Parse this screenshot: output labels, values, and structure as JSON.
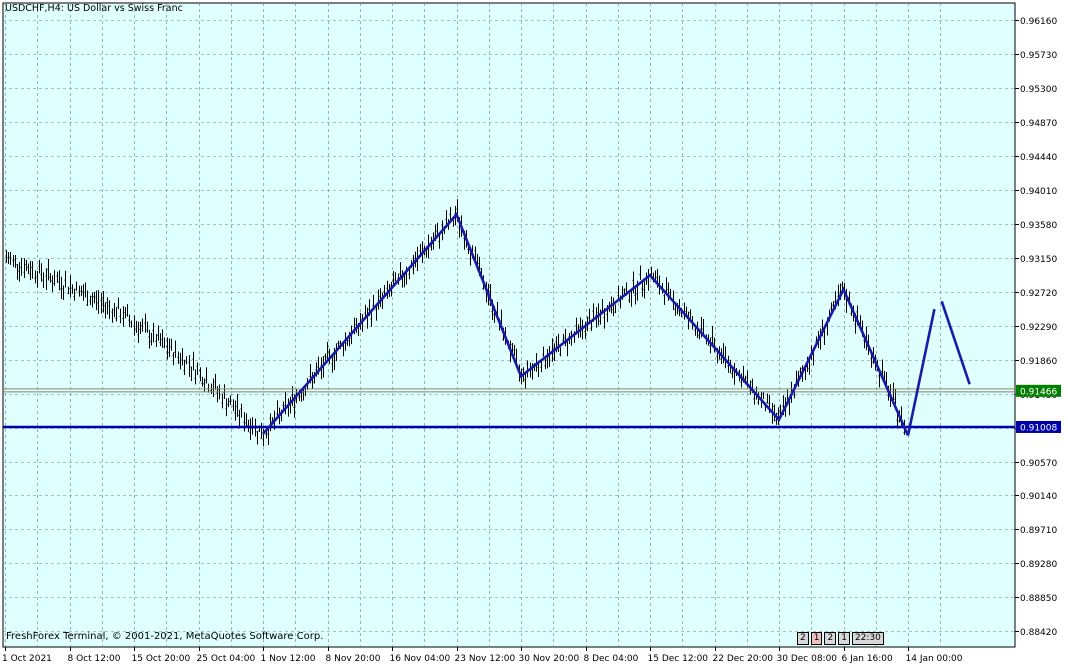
{
  "header": {
    "symbol": "USDCHF,H4:",
    "description": "US Dollar vs Swiss Franc"
  },
  "footer": {
    "copyright": "FreshForex Terminal, © 2001-2021, MetaQuotes Software Corp.",
    "timeframe_buttons": [
      "2",
      "1",
      "2",
      "1",
      "22:30"
    ]
  },
  "colors": {
    "background": "#e0ffff",
    "grid": "#5f8a8a",
    "candles": "#000000",
    "zigzag": "#1a1aa8",
    "level_line": "#0000aa",
    "bid_line": "#808080",
    "bid_badge": "#008000",
    "level_badge": "#0000aa"
  },
  "chart_data": {
    "type": "line",
    "instrument": "USDCHF",
    "timeframe": "H4",
    "ylim": [
      0.8822,
      0.9638
    ],
    "price_ticks": [
      "0.96160",
      "0.95730",
      "0.95300",
      "0.94870",
      "0.94440",
      "0.94010",
      "0.93580",
      "0.93150",
      "0.92720",
      "0.92290",
      "0.91860",
      "0.91430",
      "0.91000",
      "0.90570",
      "0.90140",
      "0.89710",
      "0.89280",
      "0.88850",
      "0.88420"
    ],
    "time_ticks": [
      "1 Oct 2021",
      "8 Oct 12:00",
      "15 Oct 20:00",
      "25 Oct 04:00",
      "1 Nov 12:00",
      "8 Nov 20:00",
      "16 Nov 04:00",
      "23 Nov 12:00",
      "30 Nov 20:00",
      "8 Dec 04:00",
      "15 Dec 12:00",
      "22 Dec 20:00",
      "30 Dec 08:00",
      "6 Jan 16:00",
      "14 Jan 00:00"
    ],
    "current_bid": "0.91466",
    "support_level": "0.91008",
    "series": [
      {
        "x": [
          "1 Nov 12:00",
          "23 Nov 12:00",
          "30 Nov 20:00",
          "15 Dec 12:00",
          "30 Dec 08:00",
          "6 Jan 16:00",
          "14 Jan 00:00"
        ],
        "values": [
          0.9092,
          0.937,
          0.9165,
          0.9293,
          0.911,
          0.9275,
          0.909
        ]
      },
      {
        "x": [
          "14 Jan 00:00",
          "17 Jan 00:00"
        ],
        "values": [
          0.909,
          0.925
        ]
      },
      {
        "x": [
          "17 Jan 20:00",
          "21 Jan 00:00"
        ],
        "values": [
          0.926,
          0.9155
        ]
      }
    ]
  }
}
